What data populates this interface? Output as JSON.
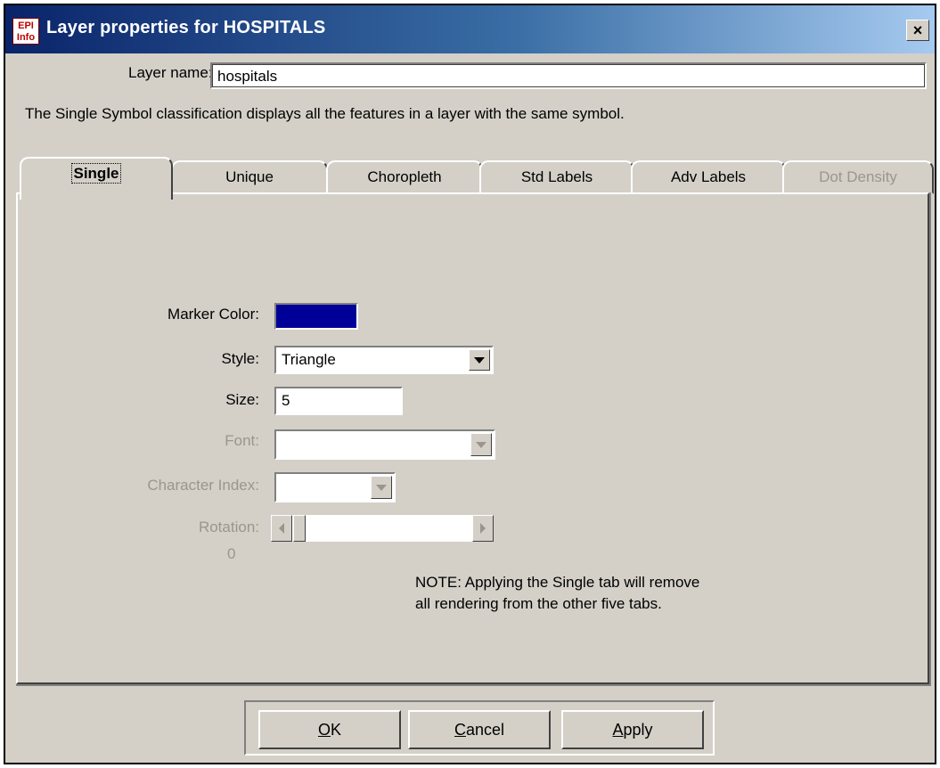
{
  "window": {
    "title": "Layer properties for HOSPITALS",
    "icon_text": "EPI Info",
    "close_glyph": "×"
  },
  "layer": {
    "label": "Layer name:",
    "value": "hospitals"
  },
  "description": "The Single Symbol classification displays all the features in a layer with the same symbol.",
  "tabs": [
    {
      "label": "Single",
      "active": true,
      "enabled": true
    },
    {
      "label": "Unique",
      "active": false,
      "enabled": true
    },
    {
      "label": "Choropleth",
      "active": false,
      "enabled": true
    },
    {
      "label": "Std Labels",
      "active": false,
      "enabled": true
    },
    {
      "label": "Adv Labels",
      "active": false,
      "enabled": true
    },
    {
      "label": "Dot Density",
      "active": false,
      "enabled": false
    }
  ],
  "single": {
    "marker_color_label": "Marker Color:",
    "marker_color": "#000099",
    "style_label": "Style:",
    "style_value": "Triangle",
    "size_label": "Size:",
    "size_value": "5",
    "font_label": "Font:",
    "font_value": "",
    "char_index_label": "Character Index:",
    "char_index_value": "",
    "rotation_label": "Rotation:",
    "rotation_value": "0",
    "note_line1": "NOTE: Applying the Single tab will remove",
    "note_line2": "all rendering from the other five tabs."
  },
  "buttons": {
    "ok_mnemonic": "O",
    "ok_rest": "K",
    "cancel_mnemonic": "C",
    "cancel_rest": "ancel",
    "apply_mnemonic": "A",
    "apply_rest": "pply"
  },
  "colors": {
    "dialog_face": "#d4d0c8",
    "title_start": "#0a246a",
    "title_end": "#a6caf0",
    "disabled_text": "#9a968e"
  }
}
